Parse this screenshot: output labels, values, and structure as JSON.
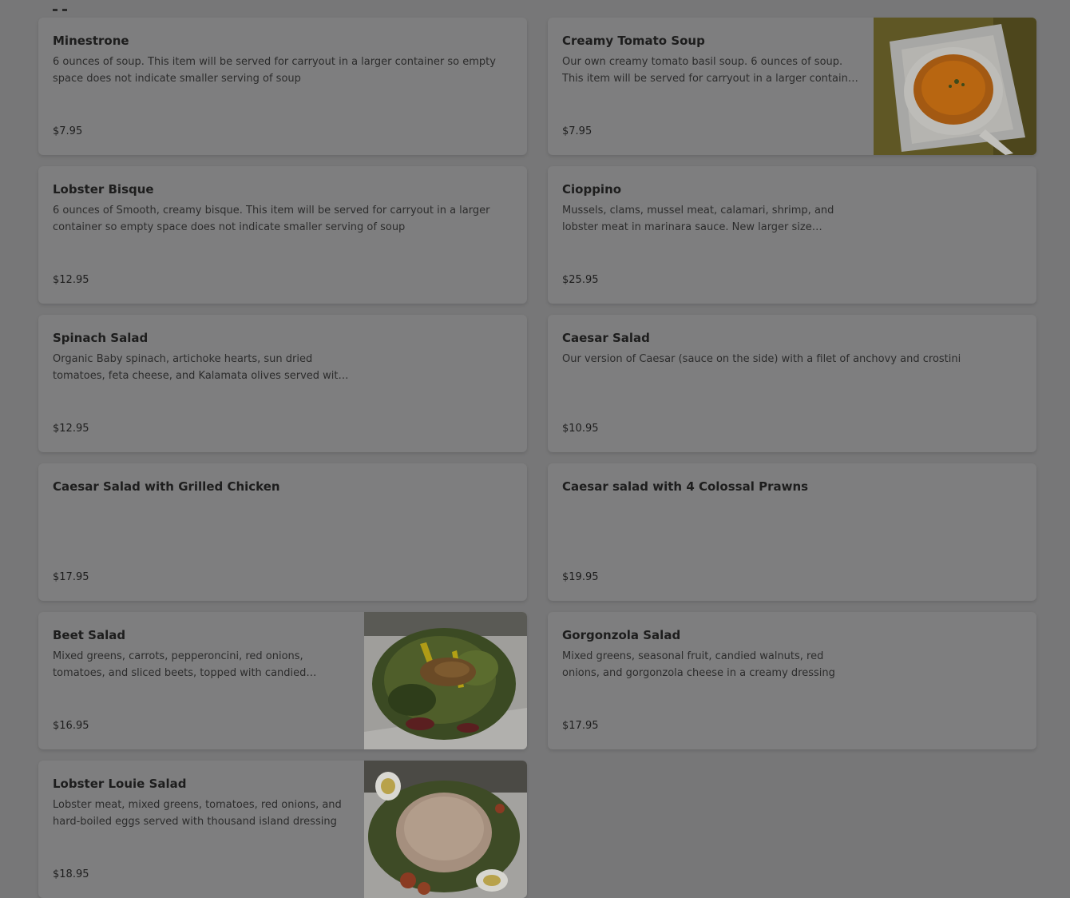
{
  "menu_items": [
    {
      "name": "Minestrone",
      "description": "6 ounces of soup. This item will be served for carryout in a larger container so empty space does not indicate smaller serving of soup",
      "price": "$7.95"
    },
    {
      "name": "Creamy Tomato Soup",
      "description": "Our own creamy tomato basil soup. 6 ounces of soup. This item will be served for carryout in a larger container so empty space does not indicate smaller serving of soup",
      "price": "$7.95"
    },
    {
      "name": "Lobster Bisque",
      "description": "6 ounces of Smooth, creamy bisque. This item will be served for carryout in a larger container so empty space does not indicate smaller serving of soup",
      "price": "$12.95"
    },
    {
      "name": "Cioppino",
      "description": "Mussels, clams, mussel meat, calamari, shrimp, and lobster meat in marinara sauce. New larger size (Carryout)",
      "price": "$25.95"
    },
    {
      "name": "Spinach Salad",
      "description": "Organic Baby spinach, artichoke hearts, sun dried tomatoes, feta cheese, and Kalamata olives served with balsamic vinaigrette",
      "price": "$12.95"
    },
    {
      "name": "Caesar Salad",
      "description": "Our version of Caesar (sauce on the side) with a filet of anchovy and crostini",
      "price": "$10.95"
    },
    {
      "name": "Caesar Salad with Grilled Chicken",
      "description": "",
      "price": "$17.95"
    },
    {
      "name": "Caesar salad with 4 Colossal Prawns",
      "description": "",
      "price": "$19.95"
    },
    {
      "name": "Beet Salad",
      "description": "Mixed greens, carrots, pepperoncini, red onions, tomatoes, and sliced beets, topped with candied walnuts",
      "price": "$16.95"
    },
    {
      "name": "Gorgonzola Salad",
      "description": "Mixed greens, seasonal fruit, candied walnuts, red onions, and gorgonzola cheese in a creamy dressing",
      "price": "$17.95"
    },
    {
      "name": "Lobster Louie Salad",
      "description": "Lobster meat, mixed greens, tomatoes, red onions, and hard-boiled eggs served with thousand island dressing",
      "price": "$18.95"
    }
  ],
  "images": {
    "soup_photo": "tomato-soup-photo",
    "beet_photo": "beet-salad-photo",
    "louie_photo": "lobster-louie-photo"
  }
}
